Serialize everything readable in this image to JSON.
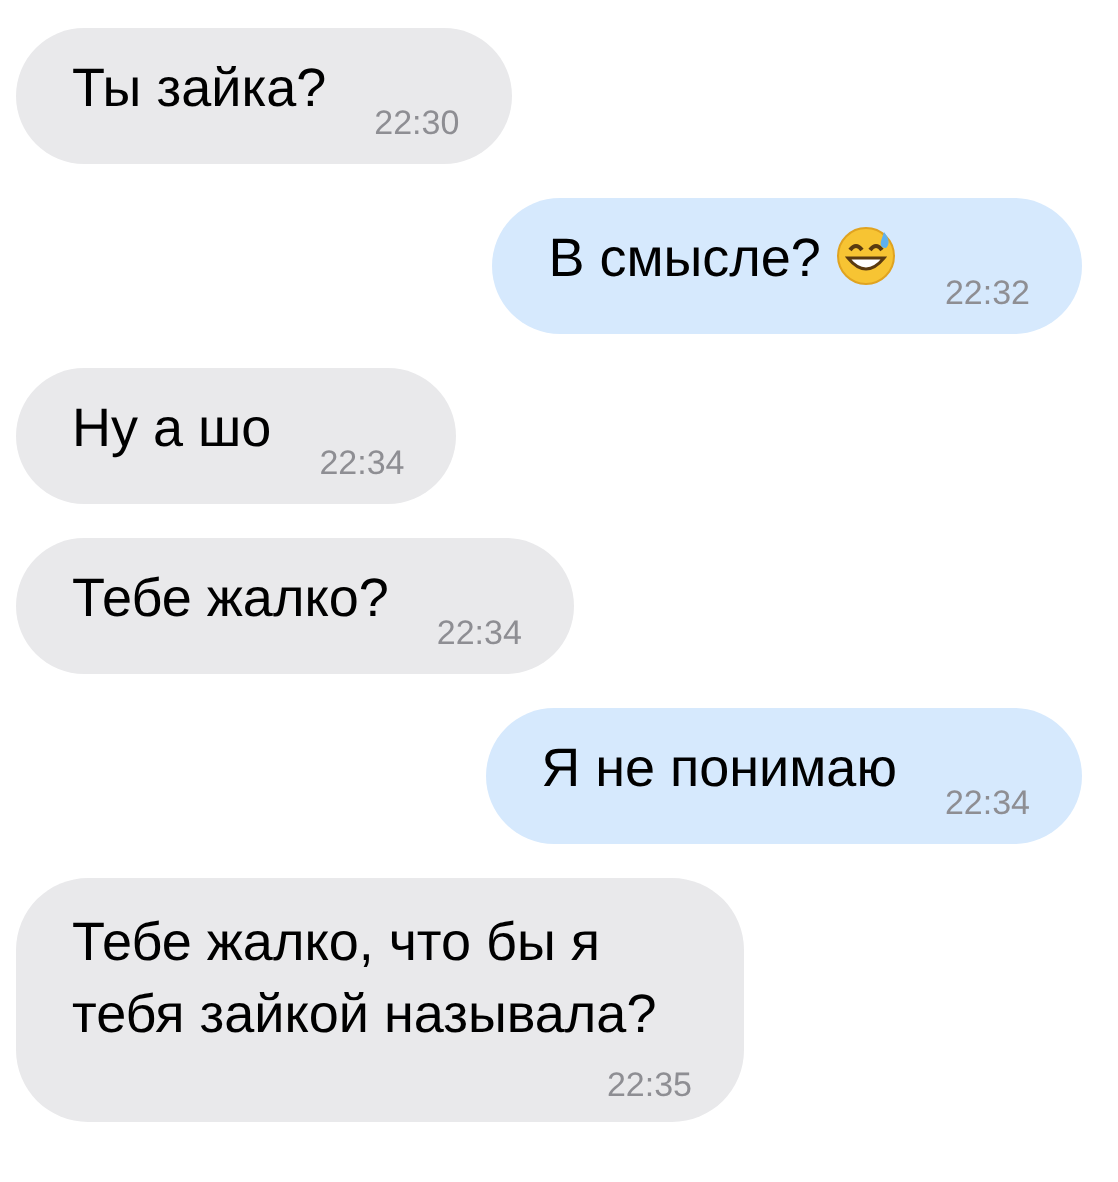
{
  "messages": [
    {
      "text": "Ты зайка?",
      "time": "22:30",
      "outgoing": false,
      "kind": "text"
    },
    {
      "text": "В смысле?",
      "time": "22:32",
      "outgoing": true,
      "kind": "emoji"
    },
    {
      "text": "Ну а шо",
      "time": "22:34",
      "outgoing": false,
      "kind": "text"
    },
    {
      "text": "Тебе жалко?",
      "time": "22:34",
      "outgoing": false,
      "kind": "text"
    },
    {
      "text": "Я не понимаю",
      "time": "22:34",
      "outgoing": true,
      "kind": "text"
    },
    {
      "text": "Тебе жалко, что бы я тебя зайкой называла?",
      "time": "22:35",
      "outgoing": false,
      "kind": "long"
    }
  ]
}
